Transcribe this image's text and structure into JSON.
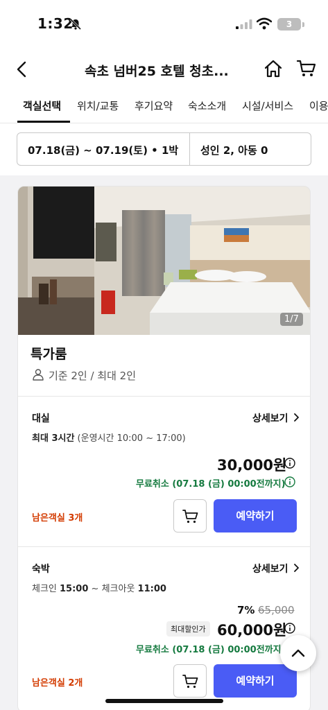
{
  "status_bar": {
    "time": "1:32",
    "battery": "3"
  },
  "header": {
    "title": "속초 넘버25 호텔 청초..."
  },
  "tabs": [
    {
      "label": "객실선택",
      "active": true
    },
    {
      "label": "위치/교통",
      "active": false
    },
    {
      "label": "후기요약",
      "active": false
    },
    {
      "label": "숙소소개",
      "active": false
    },
    {
      "label": "시설/서비스",
      "active": false
    },
    {
      "label": "이용",
      "active": false
    }
  ],
  "search": {
    "dates": "07.18(금) ~ 07.19(토) • 1박",
    "guests": "성인 2, 아동 0"
  },
  "room": {
    "photo_counter": "1/7",
    "name": "특가룸",
    "capacity": "기준 2인 / 최대 2인",
    "plans": [
      {
        "type": "대실",
        "detail_link": "상세보기",
        "desc_bold": "최대 3시간",
        "desc_rest": " (운영시간 10:00 ~ 17:00)",
        "price": "30,000원",
        "cancel": "무료취소 (07.18 (금) 00:00전까지)",
        "rooms_left": "남은객실 3개",
        "reserve_label": "예약하기"
      },
      {
        "type": "숙박",
        "detail_link": "상세보기",
        "checkin_label": "체크인 ",
        "checkin_time": "15:00",
        "checkout_label": " ~ 체크아웃 ",
        "checkout_time": "11:00",
        "discount_rate": "7%",
        "original_price": "65,000",
        "max_discount_label": "최대할인가",
        "price": "60,000원",
        "cancel": "무료취소 (07.18 (금) 00:00전까지)",
        "rooms_left": "남은객실 2개",
        "reserve_label": "예약하기"
      }
    ]
  },
  "colors": {
    "accent": "#4a5cf5",
    "cancel_green": "#157a3f",
    "rooms_left_red": "#d33b00"
  },
  "icons": [
    "bell-off-icon",
    "signal-icon",
    "wifi-icon",
    "back-icon",
    "home-icon",
    "cart-icon",
    "person-icon",
    "chevron-right-icon",
    "info-icon",
    "chevron-up-icon"
  ]
}
